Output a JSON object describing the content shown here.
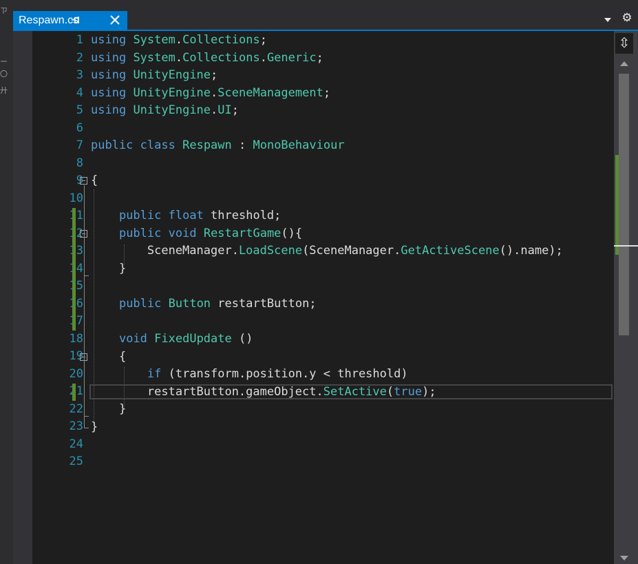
{
  "window": {
    "left_glyphs": [
      "ㄗ",
      "ー",
      "〇",
      "廾"
    ]
  },
  "tab": {
    "title": "Respawn.cs"
  },
  "colors": {
    "accent": "#007acc",
    "line_number": "#2b91af",
    "keyword": "#569cd6",
    "type": "#4ec9b0",
    "method": "#dcdcaa",
    "text": "#dcdcdc",
    "change_marker": "#5a8c33",
    "editor_bg": "#1e1e1e"
  },
  "icons": {
    "pin": "pin-icon",
    "close": "close-icon",
    "dropdown": "chevron-down-icon",
    "settings": "gear-icon",
    "split": "split-icon"
  },
  "editor": {
    "line_numbers": [
      "1",
      "2",
      "3",
      "4",
      "5",
      "6",
      "7",
      "8",
      "9",
      "10",
      "11",
      "12",
      "13",
      "14",
      "15",
      "16",
      "17",
      "18",
      "19",
      "20",
      "21",
      "22",
      "23",
      "24",
      "25"
    ],
    "current_line": 21,
    "modified_lines": [
      11,
      12,
      13,
      14,
      15,
      16,
      17,
      21
    ],
    "code": {
      "l1": [
        "using",
        " ",
        "System",
        ".",
        "Collections",
        ";"
      ],
      "l2": [
        "using",
        " ",
        "System",
        ".",
        "Collections",
        ".",
        "Generic",
        ";"
      ],
      "l3": [
        "using",
        " ",
        "UnityEngine",
        ";"
      ],
      "l4": [
        "using",
        " ",
        "UnityEngine",
        ".",
        "SceneManagement",
        ";"
      ],
      "l5": [
        "using",
        " ",
        "UnityEngine",
        ".",
        "UI",
        ";"
      ],
      "l7": [
        "public",
        " ",
        "class",
        " ",
        "Respawn",
        " : ",
        "MonoBehaviour"
      ],
      "l9": [
        "{"
      ],
      "l11": [
        "    ",
        "public",
        " ",
        "float",
        " threshold;"
      ],
      "l12": [
        "    ",
        "public",
        " ",
        "void",
        " ",
        "RestartGame",
        "(){"
      ],
      "l13": [
        "        SceneManager.",
        "LoadScene",
        "(SceneManager.",
        "GetActiveScene",
        "().name);"
      ],
      "l14": [
        "    }"
      ],
      "l16": [
        "    ",
        "public",
        " ",
        "Button",
        " restartButton;"
      ],
      "l18": [
        "    ",
        "void",
        " ",
        "FixedUpdate",
        " ()"
      ],
      "l19": [
        "    {"
      ],
      "l20": [
        "        ",
        "if",
        " (transform.position.y < threshold)"
      ],
      "l21": [
        "        restartButton.gameObject.",
        "SetActive",
        "(",
        "true",
        ");"
      ],
      "l22": [
        "    }"
      ],
      "l23": [
        "}"
      ]
    }
  }
}
